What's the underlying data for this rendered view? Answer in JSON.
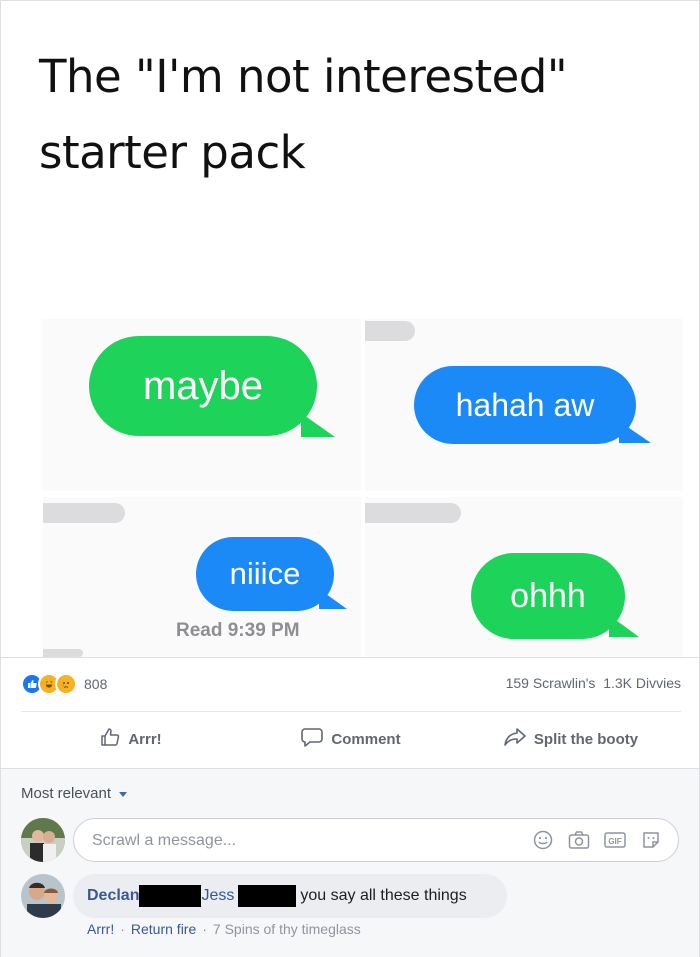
{
  "post": {
    "title_line1": "The \"I'm not interested\"",
    "title_line2": "starter pack",
    "bubbles": {
      "maybe": "maybe",
      "hahah": "hahah aw",
      "niiice": "niiice",
      "ohhh": "ohhh",
      "read_receipt": "Read 9:39 PM"
    }
  },
  "stats": {
    "reaction_count": "808",
    "comments": "159 Scrawlin's",
    "shares": "1.3K Divvies"
  },
  "actions": {
    "like": "Arrr!",
    "comment": "Comment",
    "share": "Split the booty"
  },
  "comments": {
    "sort_label": "Most relevant",
    "composer_placeholder": "Scrawl a message...",
    "composer_icons": [
      "smiley-icon",
      "camera-icon",
      "gif-icon",
      "sticker-icon"
    ],
    "items": [
      {
        "author": "Declan",
        "tag": "Jess",
        "text": "you say all these things",
        "like": "Arrr!",
        "reply": "Return fire",
        "time": "7 Spins of thy timeglass"
      }
    ]
  },
  "colors": {
    "imessage_green": "#1ed35a",
    "imessage_blue": "#1b8af6",
    "link_blue": "#385898"
  }
}
